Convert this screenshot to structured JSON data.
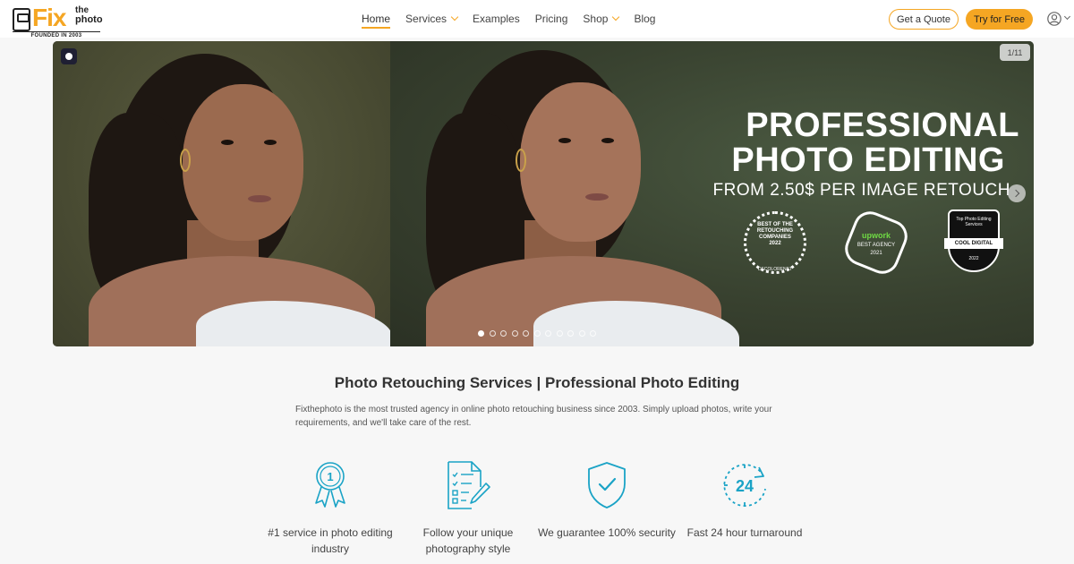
{
  "header": {
    "logo": {
      "word": "Fix",
      "word2_top": "the",
      "word2_bottom": "photo",
      "tagline": "FOUNDED IN 2003"
    },
    "nav": [
      {
        "label": "Home",
        "active": true,
        "dropdown": false
      },
      {
        "label": "Services",
        "active": false,
        "dropdown": true
      },
      {
        "label": "Examples",
        "active": false,
        "dropdown": false
      },
      {
        "label": "Pricing",
        "active": false,
        "dropdown": false
      },
      {
        "label": "Shop",
        "active": false,
        "dropdown": true
      },
      {
        "label": "Blog",
        "active": false,
        "dropdown": false
      }
    ],
    "quote_button": "Get a Quote",
    "try_button": "Try for Free",
    "user_icon": "user-circle-icon"
  },
  "hero": {
    "counter": "1/11",
    "title_line1": "PROFESSIONAL",
    "title_line2": "PHOTO EDITING",
    "subtitle": "FROM 2.50$ PER IMAGE RETOUCH",
    "badges": {
      "laurel": {
        "text": "BEST OF THE RETOUCHING COMPANIES",
        "year": "2022",
        "footer": "DECOLORENET"
      },
      "upwork": {
        "brand": "upwork",
        "title": "BEST AGENCY",
        "year": "2021"
      },
      "shield": {
        "top": "Top Photo Editing Services",
        "ribbon": "COOL DIGITAL",
        "year": "2022"
      }
    },
    "slide_count": 11,
    "active_slide": 1
  },
  "content": {
    "title": "Photo Retouching Services | Professional Photo Editing",
    "intro": "Fixthephoto is the most trusted agency in online photo retouching business since 2003. Simply upload photos, write your requirements, and we'll take care of the rest.",
    "features": [
      {
        "icon": "award-medal-icon",
        "label": "#1 service in photo editing industry",
        "medal_number": "1"
      },
      {
        "icon": "checklist-pencil-icon",
        "label": "Follow your unique photography style"
      },
      {
        "icon": "shield-check-icon",
        "label": "We guarantee 100% security"
      },
      {
        "icon": "clock-24-icon",
        "label": "Fast 24 hour turnaround",
        "clock_number": "24"
      }
    ]
  },
  "colors": {
    "accent": "#f5a623",
    "icon_teal": "#1aa3c6",
    "hero_bg": "#38412f"
  }
}
